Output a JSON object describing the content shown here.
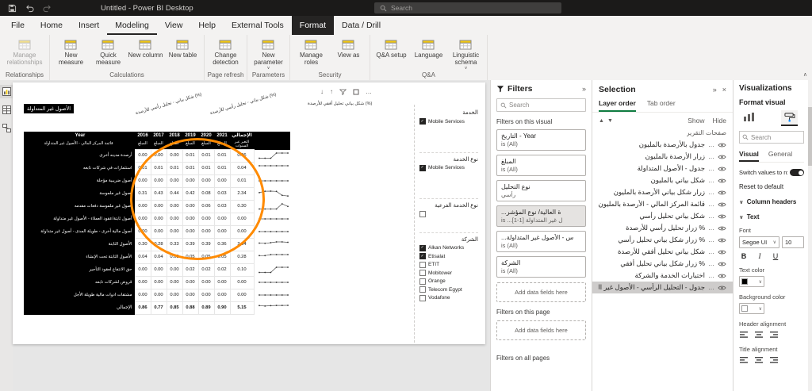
{
  "titlebar": {
    "title": "Untitled - Power BI Desktop",
    "search_placeholder": "Search"
  },
  "colors": {
    "annotation": "#ff8a00",
    "selection_tab_underline": "#107c41",
    "ribbon_contextual_bg": "#252423",
    "titlebar_bg": "#1b1a19",
    "matrix_header_bg": "#000000"
  },
  "icons": {
    "search": "magnifier",
    "filters": "funnel",
    "visibility": "eye",
    "more": "ellipsis",
    "drill_down": "down-arrow",
    "drill_up": "up-arrow",
    "focus": "frame",
    "collapse_ribbon": "chevron-up",
    "collapse_pane": "double-chevron",
    "close": "x"
  },
  "ribbon": {
    "tabs": [
      {
        "label": "File"
      },
      {
        "label": "Home"
      },
      {
        "label": "Insert"
      },
      {
        "label": "Modeling",
        "active": true
      },
      {
        "label": "View"
      },
      {
        "label": "Help"
      },
      {
        "label": "External Tools"
      },
      {
        "label": "Format",
        "contextual": true
      },
      {
        "label": "Data / Drill"
      }
    ],
    "groups": [
      {
        "label": "Relationships",
        "buttons": [
          {
            "label": "Manage relationships",
            "disabled": true,
            "wide": true
          }
        ]
      },
      {
        "label": "Calculations",
        "buttons": [
          {
            "label": "New measure"
          },
          {
            "label": "Quick measure"
          },
          {
            "label": "New column"
          },
          {
            "label": "New table"
          }
        ]
      },
      {
        "label": "Page refresh",
        "buttons": [
          {
            "label": "Change detection"
          }
        ]
      },
      {
        "label": "Parameters",
        "buttons": [
          {
            "label": "New parameter",
            "dropdown": true
          }
        ]
      },
      {
        "label": "Security",
        "buttons": [
          {
            "label": "Manage roles"
          },
          {
            "label": "View as"
          }
        ]
      },
      {
        "label": "Q&A",
        "buttons": [
          {
            "label": "Q&A setup"
          },
          {
            "label": "Language"
          },
          {
            "label": "Linguistic schema",
            "dropdown": true
          }
        ]
      }
    ]
  },
  "canvas": {
    "rotated_header_1": "(%) شكل بياني - تحليل رأسي للأرصدة",
    "rotated_header_2": "(%) شكل بياني - تحليل رأسي للأرصدة",
    "horizontal_header": "(%) شكل بياني تحليل أفقي للأرصدة",
    "table": {
      "title": "الأصول غير المتداولة",
      "corner_top": "Year",
      "corner_sub": "قائمة المركز المالي - الأصول غير المتداولة",
      "years": [
        "2016",
        "2017",
        "2018",
        "2019",
        "2020",
        "2021"
      ],
      "amount_label": "المبلغ",
      "total_label": "الإجمالي",
      "change_label": "التغير عبر السنوات",
      "rows": [
        {
          "label": "أرصدة مدينه أخرى",
          "values": [
            "0.00",
            "0.00",
            "0.00",
            "0.01",
            "0.01",
            "0.01"
          ],
          "total": "0.06"
        },
        {
          "label": "استثمارات في شركات تابعه",
          "values": [
            "0.01",
            "0.01",
            "0.01",
            "0.01",
            "0.01",
            "0.01"
          ],
          "total": "0.04"
        },
        {
          "label": "أصول ضريبية مؤجلة",
          "values": [
            "0.00",
            "0.00",
            "0.00",
            "0.00",
            "0.00",
            "0.00"
          ],
          "total": "0.01"
        },
        {
          "label": "أصول غير ملموسة",
          "values": [
            "0.31",
            "0.43",
            "0.44",
            "0.42",
            "0.08",
            "0.03"
          ],
          "total": "2.34"
        },
        {
          "label": "أصول غير ملموسة دفعات مقدمه",
          "values": [
            "0.00",
            "0.00",
            "0.00",
            "0.00",
            "0.06",
            "0.03"
          ],
          "total": "0.30"
        },
        {
          "label": "أصول ثابتة/عقود العملاء - الأصول غير متداولة",
          "values": [
            "0.00",
            "0.00",
            "0.00",
            "0.00",
            "0.00",
            "0.00"
          ],
          "total": "0.00"
        },
        {
          "label": "أصول مالية أخرى - طويلة المدى - أصول غير متداولة",
          "values": [
            "0.00",
            "0.00",
            "0.00",
            "0.00",
            "0.00",
            "0.00"
          ],
          "total": "0.00"
        },
        {
          "label": "الأصول الثابتة",
          "values": [
            "0.30",
            "0.28",
            "0.33",
            "0.39",
            "0.39",
            "0.36"
          ],
          "total": "2.04"
        },
        {
          "label": "الأصول الثابتة تحت الإنشاء",
          "values": [
            "0.04",
            "0.04",
            "0.05",
            "0.05",
            "0.05",
            "0.05"
          ],
          "total": "0.28"
        },
        {
          "label": "حق الانتفاع لعقود التأجير",
          "values": [
            "0.00",
            "0.00",
            "0.00",
            "0.02",
            "0.02",
            "0.02"
          ],
          "total": "0.10"
        },
        {
          "label": "قروض لشركات تابعه",
          "values": [
            "0.00",
            "0.00",
            "0.00",
            "0.00",
            "0.00",
            "0.00"
          ],
          "total": "0.00"
        },
        {
          "label": "مشتقات ادوات مالية طويلة الأجل",
          "values": [
            "0.00",
            "0.00",
            "0.00",
            "0.00",
            "0.00",
            "0.00"
          ],
          "total": "0.00"
        }
      ],
      "grand_total": {
        "label": "الإجمالي",
        "values": [
          "0.86",
          "0.77",
          "0.85",
          "0.88",
          "0.89",
          "0.90"
        ],
        "total": "5.15"
      }
    },
    "slicers": [
      {
        "title": "الخدمة",
        "options": [
          {
            "label": "Mobile Services",
            "checked": true
          }
        ]
      },
      {
        "title": "نوع الخدمة",
        "options": [
          {
            "label": "Mobile Services",
            "checked": true
          }
        ]
      },
      {
        "title": "نوع الخدمة الفرعية",
        "options": [
          {
            "label": "",
            "checked": false
          }
        ]
      },
      {
        "title": "الشركة",
        "options": [
          {
            "label": "Alkan Networks",
            "checked": true
          },
          {
            "label": "Etisalat",
            "checked": true
          },
          {
            "label": "ETIT",
            "checked": false
          },
          {
            "label": "Mobitower",
            "checked": false
          },
          {
            "label": "Orange",
            "checked": false
          },
          {
            "label": "Telecom Egypt",
            "checked": false
          },
          {
            "label": "Vodafone",
            "checked": false
          }
        ]
      }
    ]
  },
  "filters_pane": {
    "title": "Filters",
    "search_placeholder": "Search",
    "section_visual": "Filters on this visual",
    "section_page": "Filters on this page",
    "section_all": "Filters on all pages",
    "add_fields": "Add data fields here",
    "cards": [
      {
        "title": "التاريخ - Year",
        "condition": "is (All)"
      },
      {
        "title": "المبلغ",
        "condition": "is (All)"
      },
      {
        "title": "نوع التحليل",
        "condition": "رأسي"
      },
      {
        "title": "...ة العالية/ نوع المؤشر",
        "condition": "is ...ل غير المتداولة [1-1]",
        "highlight": true
      },
      {
        "title": "...س - الأصول غير المتداولة",
        "condition": "is (All)"
      },
      {
        "title": "الشركة",
        "condition": "is (All)"
      }
    ]
  },
  "selection_pane": {
    "title": "Selection",
    "tabs": [
      "Layer order",
      "Tab order"
    ],
    "show_label": "Show",
    "hide_label": "Hide",
    "items": [
      {
        "label": "صفحات التقرير",
        "header": true
      },
      {
        "label": "جدول بالأرصدة بالمليون"
      },
      {
        "label": "زرار الأرصدة بالمليون"
      },
      {
        "label": "جدول - الأصول المتداولة"
      },
      {
        "label": "شكل بياني بالمليون"
      },
      {
        "label": "زرار شكل بياني الأرصدة بالمليون"
      },
      {
        "label": "قائمة المركز المالي - الأرصدة بالمليون"
      },
      {
        "label": "شكل بياني تحليل رأسي"
      },
      {
        "label": "% زرار تحليل رأسي للأرصدة"
      },
      {
        "label": "% زرار شكل بياني تحليل رأسي"
      },
      {
        "label": "شكل بياني تحليل أفقي للأرصدة"
      },
      {
        "label": "% زرار شكل بياني تحليل أفقي"
      },
      {
        "label": "اختبارات الخدمة والشركة"
      },
      {
        "label": "جدول - التحليل الرأسي - الأصول غير المتداولة",
        "selected": true
      }
    ]
  },
  "viz_pane": {
    "title": "Visualizations",
    "subtitle": "Format visual",
    "search_placeholder": "Search",
    "tab_visual": "Visual",
    "tab_general": "General",
    "switch_label": "Switch values to ro...",
    "reset_label": "Reset to default",
    "column_headers_label": "Column headers",
    "text_label": "Text",
    "font_label": "Font",
    "font_value": "Segoe UI",
    "font_size": "10",
    "bold_label": "B",
    "italic_label": "I",
    "underline_label": "U",
    "text_color_label": "Text color",
    "bg_color_label": "Background color",
    "header_align_label": "Header alignment",
    "title_align_label": "Title alignment"
  }
}
